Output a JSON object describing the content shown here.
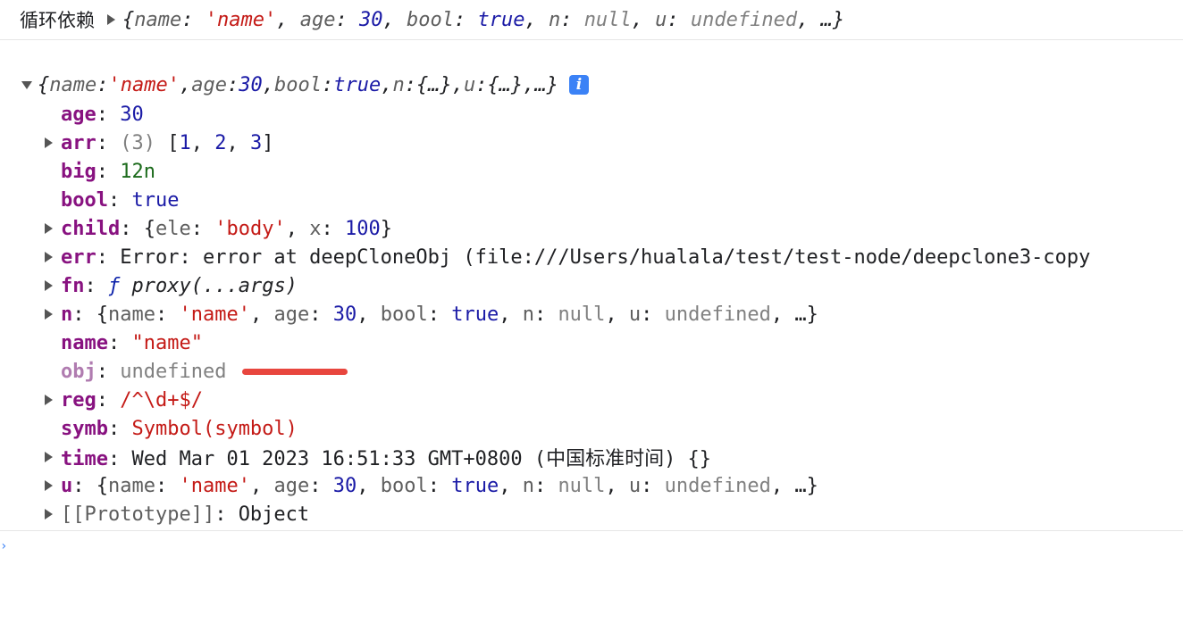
{
  "summary_row": {
    "label": "循环依赖",
    "preview": {
      "open": "{",
      "k_name": "name",
      "v_name": "'name'",
      "k_age": "age",
      "v_age": "30",
      "k_bool": "bool",
      "v_bool": "true",
      "k_n": "n",
      "v_n": "null",
      "k_u": "u",
      "v_u": "undefined",
      "tail": "…}"
    }
  },
  "object": {
    "head": {
      "open": "{",
      "k_name": "name",
      "v_name": "'name'",
      "k_age": "age",
      "v_age": "30",
      "k_bool": "bool",
      "v_bool": "true",
      "k_n": "n",
      "v_n": "{…}",
      "k_u": "u",
      "v_u": "{…}",
      "tail": "…}",
      "info_icon": "i"
    },
    "props": {
      "age": {
        "key": "age",
        "value": "30"
      },
      "arr": {
        "key": "arr",
        "count": "(3)",
        "open": "[",
        "v1": "1",
        "v2": "2",
        "v3": "3",
        "close": "]"
      },
      "big": {
        "key": "big",
        "value": "12n"
      },
      "bool": {
        "key": "bool",
        "value": "true"
      },
      "child": {
        "key": "child",
        "open": "{",
        "k_ele": "ele",
        "v_ele": "'body'",
        "k_x": "x",
        "v_x": "100",
        "close": "}"
      },
      "err": {
        "key": "err",
        "value": "Error: error at deepCloneObj (file:///Users/hualala/test/test-node/deepclone3-copy"
      },
      "fn": {
        "key": "fn",
        "f": "ƒ",
        "value": "proxy(...args)"
      },
      "n": {
        "key": "n",
        "open": "{",
        "k_name": "name",
        "v_name": "'name'",
        "k_age": "age",
        "v_age": "30",
        "k_bool": "bool",
        "v_bool": "true",
        "k_n": "n",
        "v_n": "null",
        "k_u": "u",
        "v_u": "undefined",
        "tail": "…}"
      },
      "name": {
        "key": "name",
        "value": "\"name\""
      },
      "obj": {
        "key": "obj",
        "value": "undefined"
      },
      "reg": {
        "key": "reg",
        "value": "/^\\d+$/"
      },
      "symb": {
        "key": "symb",
        "value": "Symbol(symbol)"
      },
      "time": {
        "key": "time",
        "value": "Wed Mar 01 2023 16:51:33 GMT+0800 (中国标准时间) {}"
      },
      "u": {
        "key": "u",
        "open": "{",
        "k_name": "name",
        "v_name": "'name'",
        "k_age": "age",
        "v_age": "30",
        "k_bool": "bool",
        "v_bool": "true",
        "k_n": "n",
        "v_n": "null",
        "k_u": "u",
        "v_u": "undefined",
        "tail": "…}"
      },
      "proto": {
        "key": "[[Prototype]]",
        "value": "Object"
      }
    }
  },
  "colors": {
    "string": "#c41a16",
    "number": "#1a1aa6",
    "key": "#881280",
    "null_undefined": "#808080",
    "annotation_underline": "#e8463e",
    "info_badge": "#3b82f6"
  }
}
